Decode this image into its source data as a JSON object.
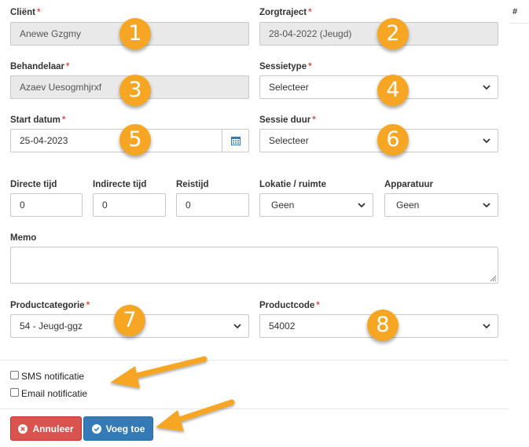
{
  "labels": {
    "client": "Cliënt",
    "zorgtraject": "Zorgtraject",
    "behandelaar": "Behandelaar",
    "sessietype": "Sessietype",
    "start_datum": "Start datum",
    "sessie_duur": "Sessie duur",
    "directe_tijd": "Directe tijd",
    "indirecte_tijd": "Indirecte tijd",
    "reistijd": "Reistijd",
    "lokatie": "Lokatie / ruimte",
    "apparatuur": "Apparatuur",
    "memo": "Memo",
    "productcategorie": "Productcategorie",
    "productcode": "Productcode",
    "required_mark": "*"
  },
  "values": {
    "client": "Anewe Gzgmy",
    "zorgtraject": "28-04-2022 (Jeugd)",
    "behandelaar": "Azaev Uesogmhjrxf",
    "sessietype": "Selecteer",
    "start_datum": "25-04-2023",
    "sessie_duur": "Selecteer",
    "directe_tijd": "0",
    "indirecte_tijd": "0",
    "reistijd": "0",
    "lokatie": "Geen",
    "apparatuur": "Geen",
    "memo": "",
    "productcategorie": "54 - Jeugd-ggz",
    "productcode": "54002"
  },
  "side": {
    "hash": "#"
  },
  "badges": [
    "1",
    "2",
    "3",
    "4",
    "5",
    "6",
    "7",
    "8"
  ],
  "checkboxes": {
    "sms": "SMS notificatie",
    "email": "Email notificatie"
  },
  "buttons": {
    "cancel": "Annuleer",
    "add": "Voeg toe"
  },
  "colors": {
    "badge": "#f6a623",
    "cancel": "#d9534f",
    "add": "#337ab7",
    "required": "#d9534f"
  }
}
